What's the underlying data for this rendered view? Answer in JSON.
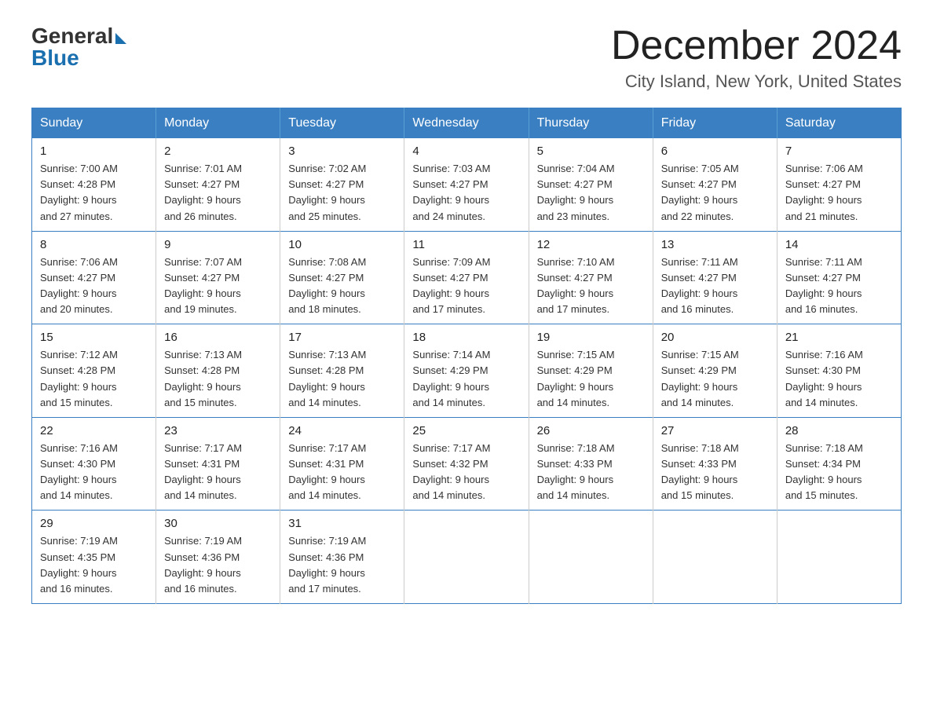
{
  "header": {
    "logo_general": "General",
    "logo_blue": "Blue",
    "main_title": "December 2024",
    "subtitle": "City Island, New York, United States"
  },
  "weekdays": [
    "Sunday",
    "Monday",
    "Tuesday",
    "Wednesday",
    "Thursday",
    "Friday",
    "Saturday"
  ],
  "weeks": [
    [
      {
        "day": "1",
        "sunrise": "7:00 AM",
        "sunset": "4:28 PM",
        "daylight": "9 hours and 27 minutes."
      },
      {
        "day": "2",
        "sunrise": "7:01 AM",
        "sunset": "4:27 PM",
        "daylight": "9 hours and 26 minutes."
      },
      {
        "day": "3",
        "sunrise": "7:02 AM",
        "sunset": "4:27 PM",
        "daylight": "9 hours and 25 minutes."
      },
      {
        "day": "4",
        "sunrise": "7:03 AM",
        "sunset": "4:27 PM",
        "daylight": "9 hours and 24 minutes."
      },
      {
        "day": "5",
        "sunrise": "7:04 AM",
        "sunset": "4:27 PM",
        "daylight": "9 hours and 23 minutes."
      },
      {
        "day": "6",
        "sunrise": "7:05 AM",
        "sunset": "4:27 PM",
        "daylight": "9 hours and 22 minutes."
      },
      {
        "day": "7",
        "sunrise": "7:06 AM",
        "sunset": "4:27 PM",
        "daylight": "9 hours and 21 minutes."
      }
    ],
    [
      {
        "day": "8",
        "sunrise": "7:06 AM",
        "sunset": "4:27 PM",
        "daylight": "9 hours and 20 minutes."
      },
      {
        "day": "9",
        "sunrise": "7:07 AM",
        "sunset": "4:27 PM",
        "daylight": "9 hours and 19 minutes."
      },
      {
        "day": "10",
        "sunrise": "7:08 AM",
        "sunset": "4:27 PM",
        "daylight": "9 hours and 18 minutes."
      },
      {
        "day": "11",
        "sunrise": "7:09 AM",
        "sunset": "4:27 PM",
        "daylight": "9 hours and 17 minutes."
      },
      {
        "day": "12",
        "sunrise": "7:10 AM",
        "sunset": "4:27 PM",
        "daylight": "9 hours and 17 minutes."
      },
      {
        "day": "13",
        "sunrise": "7:11 AM",
        "sunset": "4:27 PM",
        "daylight": "9 hours and 16 minutes."
      },
      {
        "day": "14",
        "sunrise": "7:11 AM",
        "sunset": "4:27 PM",
        "daylight": "9 hours and 16 minutes."
      }
    ],
    [
      {
        "day": "15",
        "sunrise": "7:12 AM",
        "sunset": "4:28 PM",
        "daylight": "9 hours and 15 minutes."
      },
      {
        "day": "16",
        "sunrise": "7:13 AM",
        "sunset": "4:28 PM",
        "daylight": "9 hours and 15 minutes."
      },
      {
        "day": "17",
        "sunrise": "7:13 AM",
        "sunset": "4:28 PM",
        "daylight": "9 hours and 14 minutes."
      },
      {
        "day": "18",
        "sunrise": "7:14 AM",
        "sunset": "4:29 PM",
        "daylight": "9 hours and 14 minutes."
      },
      {
        "day": "19",
        "sunrise": "7:15 AM",
        "sunset": "4:29 PM",
        "daylight": "9 hours and 14 minutes."
      },
      {
        "day": "20",
        "sunrise": "7:15 AM",
        "sunset": "4:29 PM",
        "daylight": "9 hours and 14 minutes."
      },
      {
        "day": "21",
        "sunrise": "7:16 AM",
        "sunset": "4:30 PM",
        "daylight": "9 hours and 14 minutes."
      }
    ],
    [
      {
        "day": "22",
        "sunrise": "7:16 AM",
        "sunset": "4:30 PM",
        "daylight": "9 hours and 14 minutes."
      },
      {
        "day": "23",
        "sunrise": "7:17 AM",
        "sunset": "4:31 PM",
        "daylight": "9 hours and 14 minutes."
      },
      {
        "day": "24",
        "sunrise": "7:17 AM",
        "sunset": "4:31 PM",
        "daylight": "9 hours and 14 minutes."
      },
      {
        "day": "25",
        "sunrise": "7:17 AM",
        "sunset": "4:32 PM",
        "daylight": "9 hours and 14 minutes."
      },
      {
        "day": "26",
        "sunrise": "7:18 AM",
        "sunset": "4:33 PM",
        "daylight": "9 hours and 14 minutes."
      },
      {
        "day": "27",
        "sunrise": "7:18 AM",
        "sunset": "4:33 PM",
        "daylight": "9 hours and 15 minutes."
      },
      {
        "day": "28",
        "sunrise": "7:18 AM",
        "sunset": "4:34 PM",
        "daylight": "9 hours and 15 minutes."
      }
    ],
    [
      {
        "day": "29",
        "sunrise": "7:19 AM",
        "sunset": "4:35 PM",
        "daylight": "9 hours and 16 minutes."
      },
      {
        "day": "30",
        "sunrise": "7:19 AM",
        "sunset": "4:36 PM",
        "daylight": "9 hours and 16 minutes."
      },
      {
        "day": "31",
        "sunrise": "7:19 AM",
        "sunset": "4:36 PM",
        "daylight": "9 hours and 17 minutes."
      },
      null,
      null,
      null,
      null
    ]
  ],
  "labels": {
    "sunrise_prefix": "Sunrise: ",
    "sunset_prefix": "Sunset: ",
    "daylight_prefix": "Daylight: "
  }
}
